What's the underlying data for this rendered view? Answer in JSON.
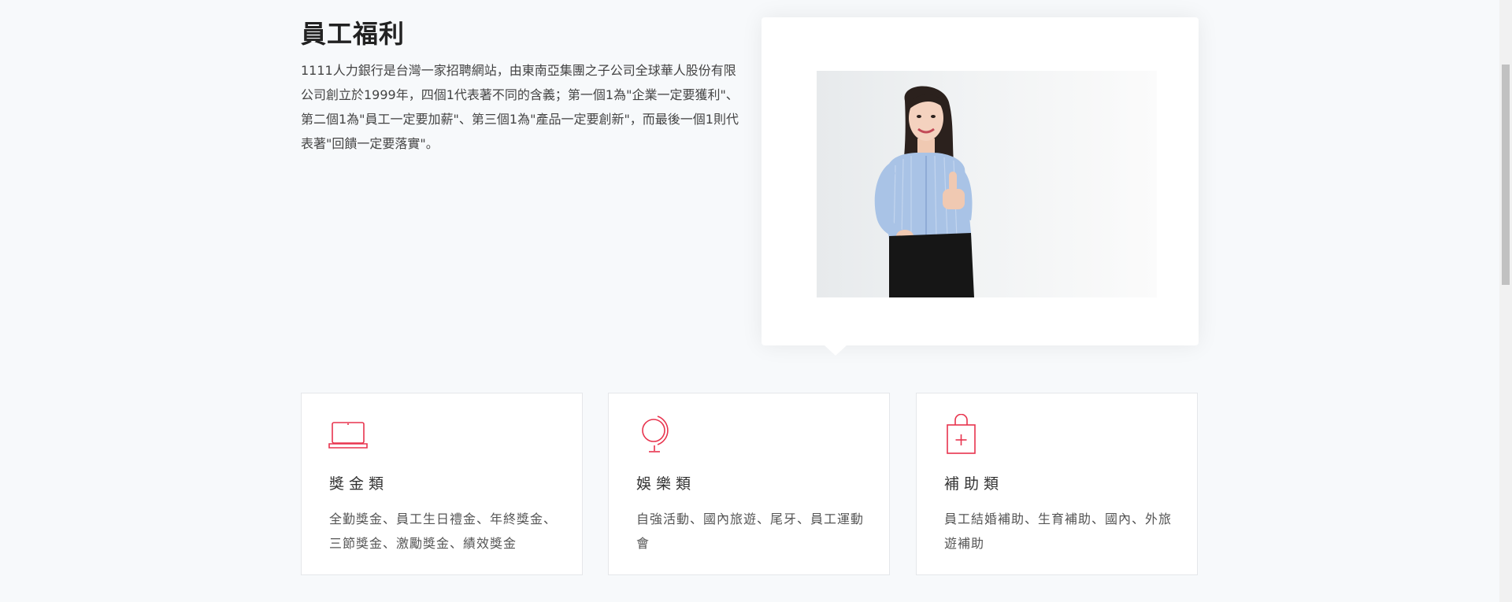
{
  "intro": {
    "title": "員工福利",
    "description": "1111人力銀行是台灣一家招聘網站，由東南亞集團之子公司全球華人股份有限公司創立於1999年，四個1代表著不同的含義；第一個1為\"企業一定要獲利\"、第二個1為\"員工一定要加薪\"、第三個1為\"產品一定要創新\"，而最後一個1則代表著\"回饋一定要落實\"。"
  },
  "benefits": [
    {
      "icon": "laptop-icon",
      "title": "獎金類",
      "text": "全勤獎金、員工生日禮金、年終獎金、三節獎金、激勵獎金、績效獎金"
    },
    {
      "icon": "globe-icon",
      "title": "娛樂類",
      "text": "自強活動、國內旅遊、尾牙、員工運動會"
    },
    {
      "icon": "shopping-bag-icon",
      "title": "補助類",
      "text": "員工結婚補助、生育補助、國內、外旅遊補助"
    }
  ],
  "colors": {
    "accent": "#e8344e",
    "background": "#f7f9fb",
    "card": "#ffffff"
  }
}
